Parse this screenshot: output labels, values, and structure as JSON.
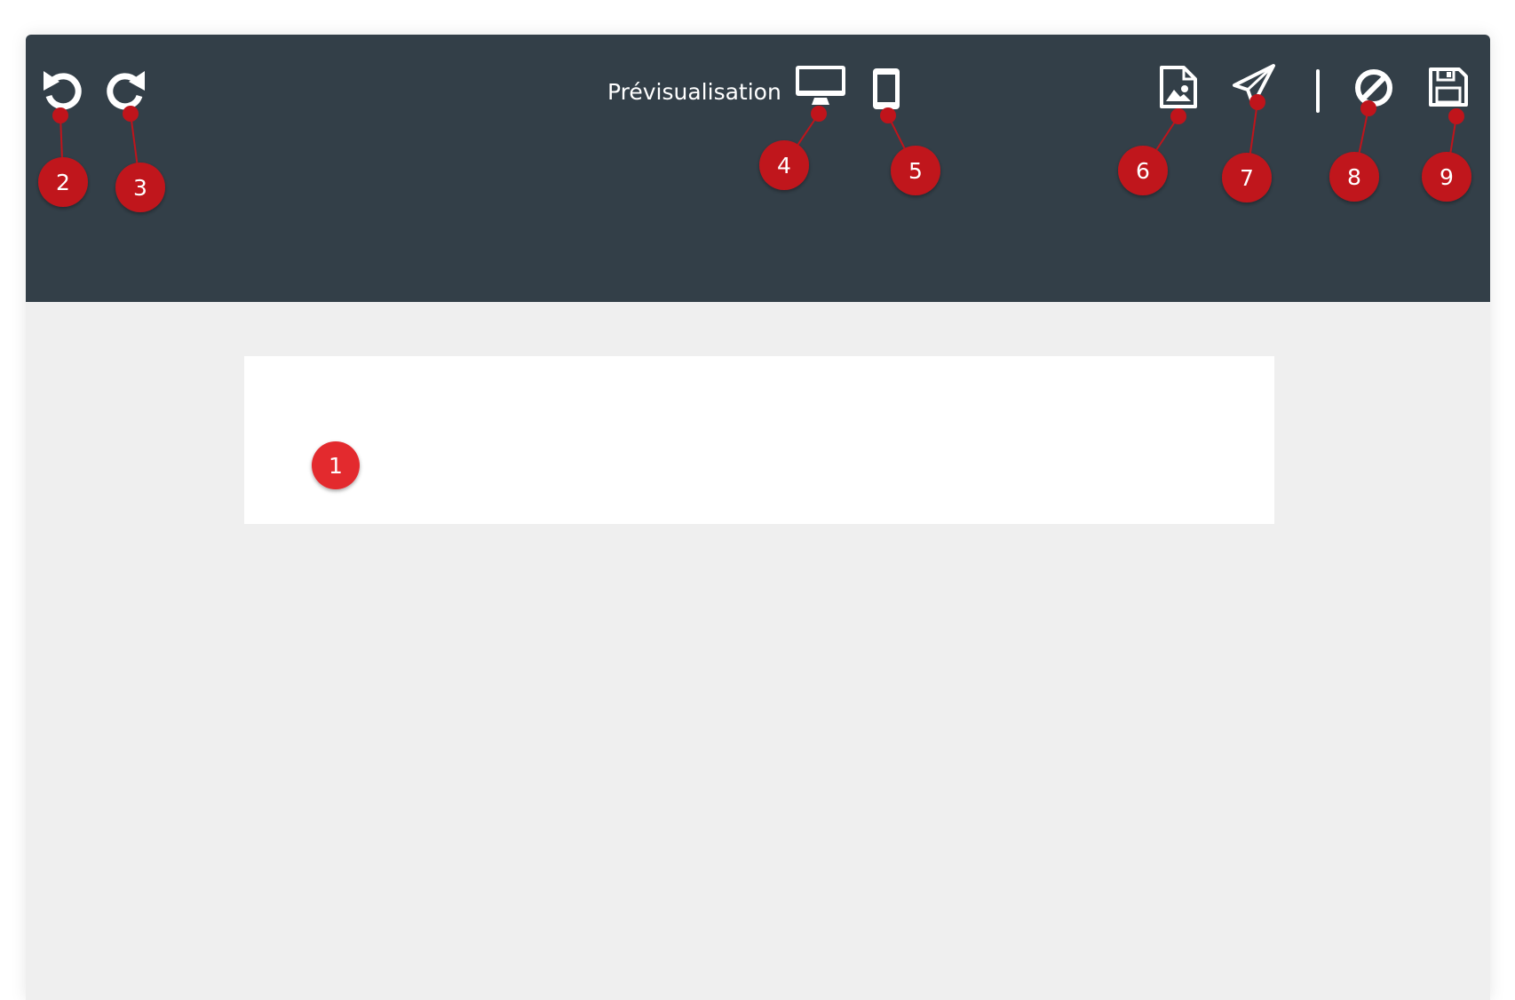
{
  "toolbar": {
    "title": "Prévisualisation",
    "buttons": [
      {
        "id": "undo",
        "icon": "undo-icon"
      },
      {
        "id": "redo",
        "icon": "redo-icon"
      },
      {
        "id": "desktop",
        "icon": "desktop-icon"
      },
      {
        "id": "mobile",
        "icon": "mobile-icon"
      },
      {
        "id": "image",
        "icon": "image-file-icon"
      },
      {
        "id": "send",
        "icon": "paper-plane-icon"
      },
      {
        "id": "cancel",
        "icon": "ban-icon"
      },
      {
        "id": "save",
        "icon": "floppy-disk-icon"
      }
    ]
  },
  "annotations": {
    "labels": [
      "1",
      "2",
      "3",
      "4",
      "5",
      "6",
      "7",
      "8",
      "9"
    ],
    "marker_color": "#c0141b",
    "marker_highlight": "#e3292e"
  },
  "colors": {
    "toolbar_bg": "#333f48",
    "workspace_bg": "#efefef",
    "canvas_bg": "#ffffff",
    "icon": "#ffffff"
  }
}
